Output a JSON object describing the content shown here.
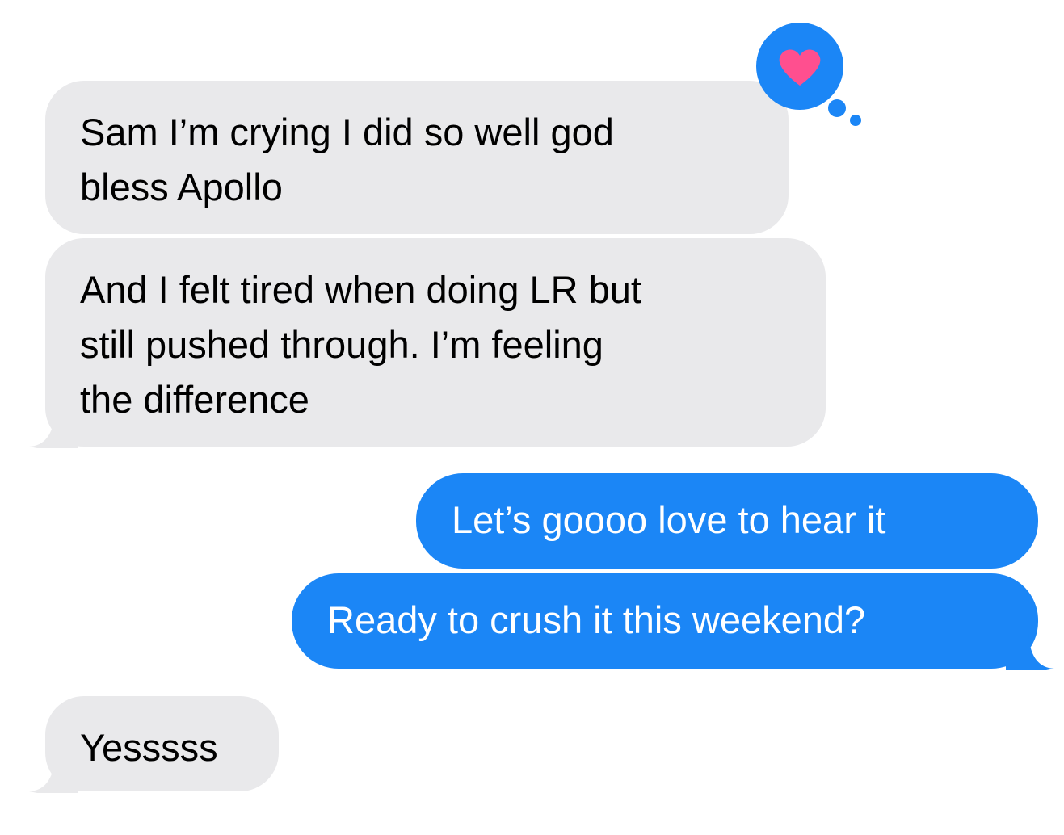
{
  "conversation": {
    "messages": [
      {
        "direction": "received",
        "lines": [
          "Sam I’m crying I did so well god",
          "bless Apollo"
        ],
        "tapback": "heart-icon"
      },
      {
        "direction": "received",
        "lines": [
          "And I felt tired when doing LR but",
          "still pushed through. I’m feeling",
          "the difference"
        ]
      },
      {
        "direction": "sent",
        "lines": [
          "Let’s goooo love to hear it"
        ]
      },
      {
        "direction": "sent",
        "lines": [
          "Ready to crush it this weekend?"
        ]
      },
      {
        "direction": "received",
        "lines": [
          "Yesssss"
        ]
      }
    ]
  },
  "colors": {
    "received_bubble": "#e9e9eb",
    "sent_bubble": "#1b86f6",
    "tapback_bubble": "#1b86f6",
    "heart": "#ff4f8f",
    "background": "#ffffff"
  }
}
